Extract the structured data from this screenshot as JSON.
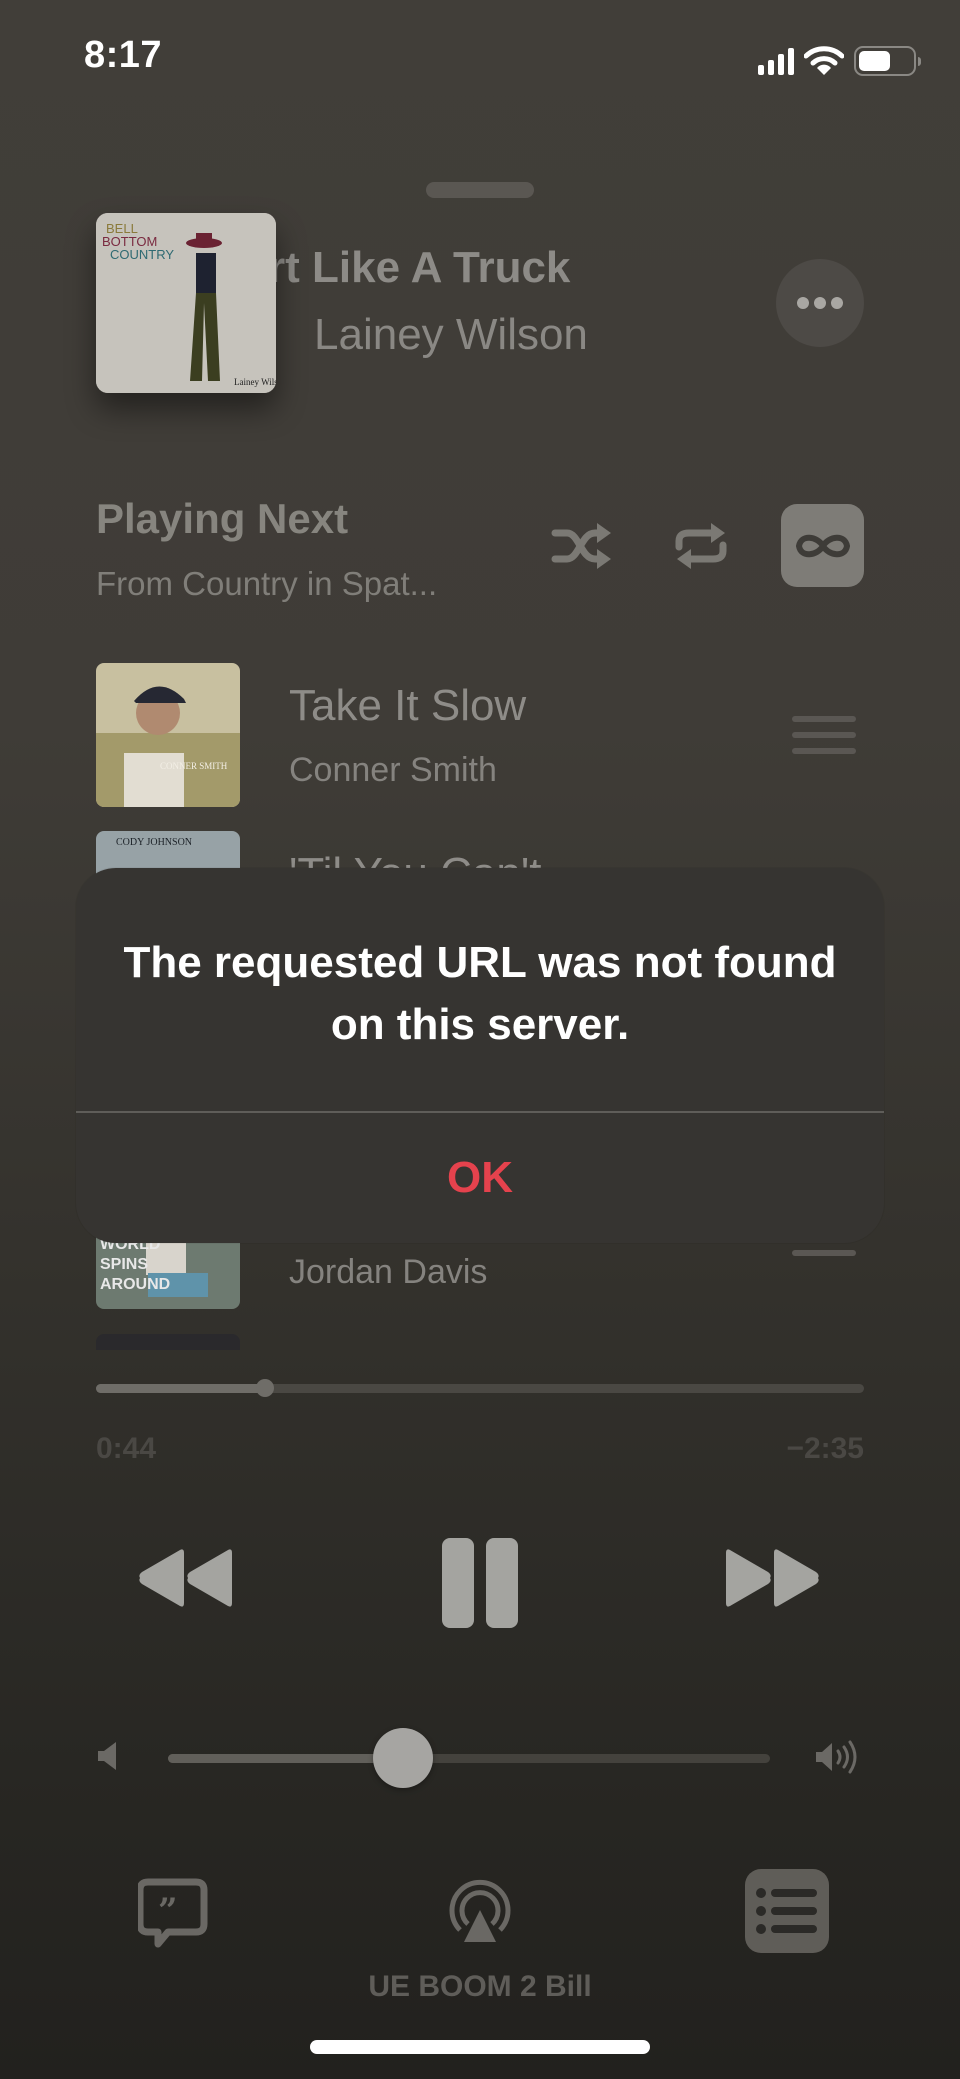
{
  "status_bar": {
    "time": "8:17",
    "icons": [
      "cellular-signal-icon",
      "wifi-icon",
      "battery-icon"
    ]
  },
  "now_playing": {
    "title_visible": "rt Like A Truck",
    "artist": "Lainey Wilson",
    "album_art_text": [
      "BELL",
      "BOTTOM",
      "COUNTRY"
    ],
    "album_art_signature": "Lainey Wilson",
    "more_icon": "ellipsis-icon"
  },
  "playing_next": {
    "title": "Playing Next",
    "subtitle": "From Country in Spat...",
    "shuffle_icon": "shuffle-icon",
    "repeat_icon": "repeat-icon",
    "autoplay_icon": "infinity-icon",
    "autoplay_active": true
  },
  "queue": [
    {
      "title": "Take It Slow",
      "artist": "Conner Smith",
      "art_text": "CONNER SMITH"
    },
    {
      "title": "'Til You Can't",
      "artist": "",
      "art_text": "CODY JOHNSON"
    },
    {
      "title": "",
      "artist": "Jordan Davis",
      "art_text": "WORLD SPINS AROUND"
    }
  ],
  "alert": {
    "message": "The requested URL was not found on this server.",
    "ok_label": "OK",
    "ok_color": "#e5424d"
  },
  "playback": {
    "elapsed": "0:44",
    "remaining": "−2:35",
    "progress_fraction": 0.22,
    "state": "playing"
  },
  "controls": {
    "rewind_icon": "rewind-icon",
    "pause_icon": "pause-icon",
    "forward_icon": "fast-forward-icon"
  },
  "volume": {
    "level_fraction": 0.39,
    "low_icon": "speaker-low-icon",
    "high_icon": "speaker-high-icon"
  },
  "bottom_bar": {
    "lyrics_icon": "lyrics-quote-bubble-icon",
    "airplay_icon": "airplay-audio-icon",
    "queue_icon": "queue-list-icon",
    "output_device": "UE BOOM 2 Bill"
  }
}
